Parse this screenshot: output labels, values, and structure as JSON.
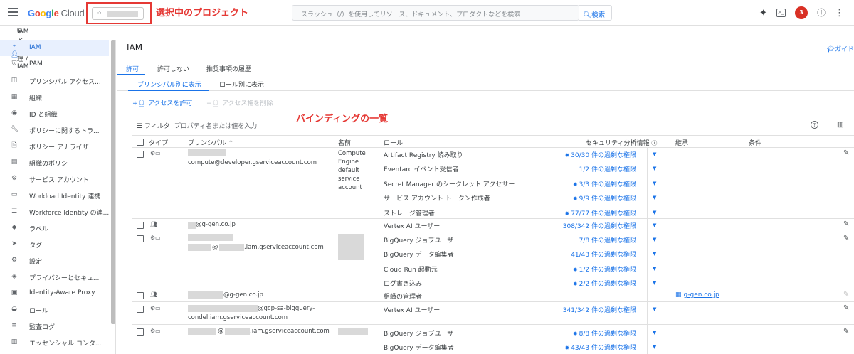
{
  "topbar": {
    "logo": {
      "g": "G",
      "o1": "o",
      "o2": "o",
      "g2": "g",
      "l": "l",
      "e": "e",
      "cloud": "Cloud"
    },
    "project_annotation": "選択中のプロジェクト",
    "search_placeholder": "スラッシュ（/）を使用してリソース、ドキュメント、プロダクトなどを検索",
    "search_button": "検索",
    "notification_count": "3"
  },
  "breadcrumb": "IAM と管理 / IAM",
  "sidebar": {
    "items": [
      {
        "label": "IAM",
        "icon": "person-add-icon",
        "active": true
      },
      {
        "label": "PAM",
        "icon": "shield-icon"
      },
      {
        "label": "プリンシパル アクセス...",
        "icon": "policy-icon"
      },
      {
        "label": "組織",
        "icon": "building-icon"
      },
      {
        "label": "ID と組織",
        "icon": "account-circle-icon"
      },
      {
        "label": "ポリシーに関するトラ...",
        "icon": "wrench-icon"
      },
      {
        "label": "ポリシー アナライザ",
        "icon": "document-search-icon"
      },
      {
        "label": "組織のポリシー",
        "icon": "article-icon"
      },
      {
        "label": "サービス アカウント",
        "icon": "service-account-icon"
      },
      {
        "label": "Workload Identity 連携",
        "icon": "id-card-icon"
      },
      {
        "label": "Workforce Identity の連...",
        "icon": "list-icon"
      },
      {
        "label": "ラベル",
        "icon": "label-icon"
      },
      {
        "label": "タグ",
        "icon": "tag-icon"
      },
      {
        "label": "設定",
        "icon": "settings-icon"
      },
      {
        "label": "プライバシーとセキュ...",
        "icon": "privacy-icon"
      },
      {
        "label": "Identity-Aware Proxy",
        "icon": "proxy-icon"
      },
      {
        "label": "ロール",
        "icon": "roles-icon"
      },
      {
        "label": "監査ログ",
        "icon": "audit-log-icon"
      },
      {
        "label": "エッセンシャル コンタ...",
        "icon": "contacts-icon"
      }
    ]
  },
  "main": {
    "title": "IAM",
    "guide": "ガイド",
    "tabs": [
      "許可",
      "許可しない",
      "推奨事項の履歴"
    ],
    "subtabs": [
      "プリンシパル別に表示",
      "ロール別に表示"
    ],
    "grant_access": "アクセスを許可",
    "remove_access": "アクセス権を削除",
    "binding_annotation": "バインディングの一覧",
    "filter_label": "フィルタ",
    "filter_placeholder": "プロパティ名または値を入力",
    "columns": {
      "type": "タイプ",
      "principal": "プリンシパル",
      "name": "名前",
      "role": "ロール",
      "insights": "セキュリティ分析情報",
      "inherited": "継承",
      "condition": "条件"
    },
    "rows": [
      {
        "principal": "compute@developer.gserviceaccount.com",
        "name": [
          "Compute",
          "Engine",
          "default",
          "service",
          "account"
        ],
        "roles": [
          {
            "role": "Artifact Registry 読み取り",
            "insight": "30/30 件の過剰な権限",
            "bulb": true
          },
          {
            "role": "Eventarc イベント受信者",
            "insight": "1/2 件の過剰な権限",
            "bulb": false
          },
          {
            "role": "Secret Manager のシークレット アクセサー",
            "insight": "3/3 件の過剰な権限",
            "bulb": true
          },
          {
            "role": "サービス アカウント トークン作成者",
            "insight": "9/9 件の過剰な権限",
            "bulb": true
          },
          {
            "role": "ストレージ管理者",
            "insight": "77/77 件の過剰な権限",
            "bulb": true
          }
        ]
      },
      {
        "principal": "@g-gen.co.jp",
        "roles": [
          {
            "role": "Vertex AI ユーザー",
            "insight": "308/342 件の過剰な権限",
            "bulb": false
          }
        ]
      },
      {
        "principal_a": "@",
        "principal_b": ".iam.gserviceaccount.com",
        "roles": [
          {
            "role": "BigQuery ジョブユーザー",
            "insight": "7/8 件の過剰な権限",
            "bulb": false
          },
          {
            "role": "BigQuery データ編集者",
            "insight": "41/43 件の過剰な権限",
            "bulb": false
          },
          {
            "role": "Cloud Run 起動元",
            "insight": "1/2 件の過剰な権限",
            "bulb": true
          },
          {
            "role": "ログ書き込み",
            "insight": "2/2 件の過剰な権限",
            "bulb": true
          }
        ]
      },
      {
        "principal": "@g-gen.co.jp",
        "roles": [
          {
            "role": "組織の管理者",
            "insight": ""
          }
        ],
        "inherited": "g-gen.co.jp"
      },
      {
        "principal_line1": "@gcp-sa-bigquery-",
        "principal_line2": "condel.iam.gserviceaccount.com",
        "roles": [
          {
            "role": "Vertex AI ユーザー",
            "insight": "341/342 件の過剰な権限",
            "bulb": false
          }
        ]
      },
      {
        "principal_a": "@",
        "principal_b": ".iam.gserviceaccount.com",
        "roles": [
          {
            "role": "BigQuery ジョブユーザー",
            "insight": "8/8 件の過剰な権限",
            "bulb": true
          },
          {
            "role": "BigQuery データ編集者",
            "insight": "43/43 件の過剰な権限",
            "bulb": true
          }
        ]
      }
    ]
  }
}
